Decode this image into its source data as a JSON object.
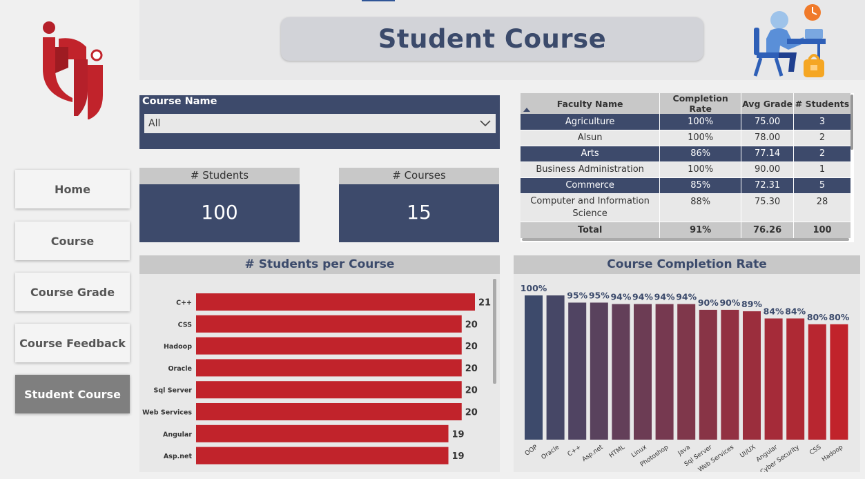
{
  "page": {
    "title": "Student Course"
  },
  "nav": {
    "items": [
      {
        "label": "Home",
        "active": false
      },
      {
        "label": "Course",
        "active": false
      },
      {
        "label": "Course Grade",
        "active": false
      },
      {
        "label": "Course Feedback",
        "active": false
      },
      {
        "label": "Student Course",
        "active": true
      }
    ]
  },
  "slicer": {
    "label": "Course Name",
    "selected": "All"
  },
  "cards": {
    "students": {
      "label": "# Students",
      "value": "100"
    },
    "courses": {
      "label": "# Courses",
      "value": "15"
    }
  },
  "faculty_table": {
    "columns": [
      "Faculty Name",
      "Completion Rate",
      "Avg Grade",
      "# Students"
    ],
    "rows": [
      [
        "Agriculture",
        "100%",
        "75.00",
        "3"
      ],
      [
        "Alsun",
        "100%",
        "78.00",
        "2"
      ],
      [
        "Arts",
        "86%",
        "77.14",
        "2"
      ],
      [
        "Business Administration",
        "100%",
        "90.00",
        "1"
      ],
      [
        "Commerce",
        "85%",
        "72.31",
        "5"
      ],
      [
        "Computer and Information Science",
        "88%",
        "75.30",
        "28"
      ]
    ],
    "total": [
      "Total",
      "91%",
      "76.26",
      "100"
    ]
  },
  "colors": {
    "navy": "#3d4a6b",
    "red": "#c1232b",
    "panel": "#e8e8e8",
    "header": "#c8c8c8"
  },
  "icons": [
    "iti-logo",
    "student-desk-illustration",
    "chevron-down-icon",
    "sort-up-icon"
  ],
  "chart_data": [
    {
      "type": "bar",
      "orientation": "horizontal",
      "title": "# Students per Course",
      "categories": [
        "C++",
        "CSS",
        "Hadoop",
        "Oracle",
        "Sql Server",
        "Web Services",
        "Angular",
        "Asp.net"
      ],
      "values": [
        21,
        20,
        20,
        20,
        20,
        20,
        19,
        19
      ],
      "xlim": [
        0,
        21
      ]
    },
    {
      "type": "bar",
      "title": "Course Completion Rate",
      "categories": [
        "OOP",
        "Oracle",
        "C++",
        "Asp.net",
        "HTML",
        "Linux",
        "Photoshop",
        "Java",
        "Sql Server",
        "Web Services",
        "UI/UX",
        "Angular",
        "Cyber Security",
        "CSS",
        "Hadoop"
      ],
      "values": [
        100,
        100,
        95,
        95,
        94,
        94,
        94,
        94,
        90,
        90,
        89,
        84,
        84,
        80,
        80
      ],
      "labels": [
        "100%",
        "",
        "95%",
        "95%",
        "94%",
        "94%",
        "94%",
        "94%",
        "90%",
        "90%",
        "89%",
        "84%",
        "84%",
        "80%",
        "80%"
      ],
      "ylim": [
        0,
        100
      ]
    }
  ]
}
